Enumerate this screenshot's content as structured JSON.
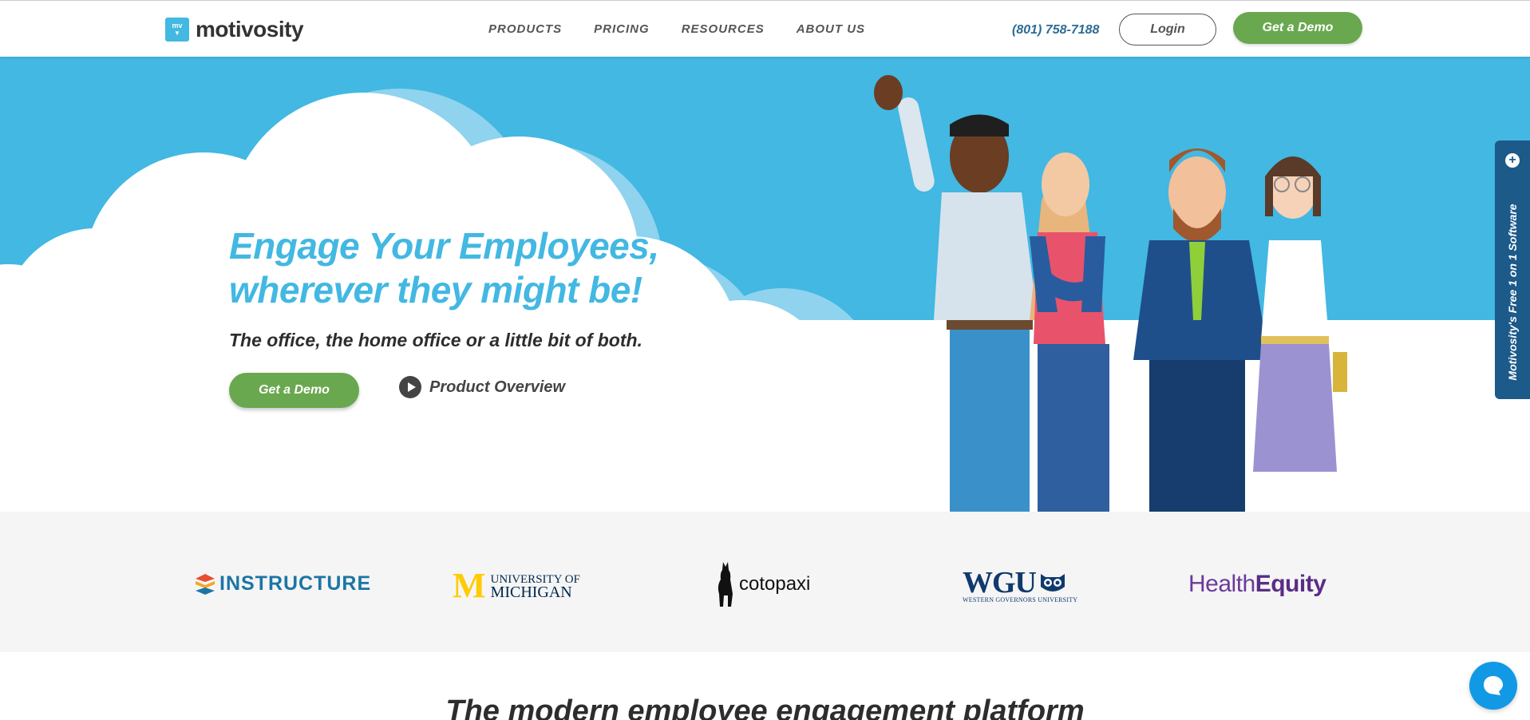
{
  "header": {
    "brand": "motivosity",
    "logo_mark": "mv",
    "nav": [
      "PRODUCTS",
      "PRICING",
      "RESOURCES",
      "ABOUT US"
    ],
    "phone": "(801) 758-7188",
    "login_label": "Login",
    "demo_label": "Get a Demo"
  },
  "hero": {
    "title_line1": "Engage Your Employees,",
    "title_line2": "wherever they might be!",
    "subtitle": "The office, the home office or a little bit of both.",
    "demo_label": "Get a Demo",
    "overview_label": "Product Overview"
  },
  "side_tab": {
    "label": "Motivosity's Free 1 on 1 Software",
    "plus": "+"
  },
  "logos": {
    "instructure": "INSTRUCTURE",
    "umich_line1": "UNIVERSITY OF",
    "umich_line2": "MICHIGAN",
    "umich_mark": "M",
    "cotopaxi": "cotopaxi",
    "wgu": "WGU",
    "wgu_sub": "WESTERN GOVERNORS UNIVERSITY",
    "healthequity_a": "Health",
    "healthequity_b": "Equity"
  },
  "section": {
    "heading": "The modern employee engagement platform"
  },
  "colors": {
    "brand_blue": "#42b8e2",
    "green": "#6aa84f",
    "navy": "#1c5a8a",
    "chat_blue": "#1199e6"
  },
  "icons": [
    "play-icon",
    "plus-icon",
    "chat-icon",
    "characters-illustration"
  ]
}
